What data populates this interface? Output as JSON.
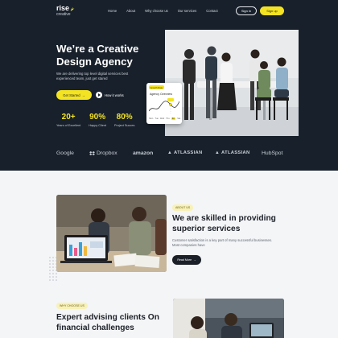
{
  "header": {
    "logo_name": "rise",
    "logo_tagline": "creative",
    "nav": [
      "Home",
      "About",
      "Why choose us",
      "Our services",
      "Contact"
    ],
    "signin_label": "Sign in",
    "signup_label": "Sign up"
  },
  "hero": {
    "title": "We’re a Creative Design Agency",
    "subtitle": "We are delivering top level digital services best experienced team, just get stared",
    "cta_label": "Get Started",
    "cta_arrow": "→",
    "how_label": "How it works",
    "photo": "image placeholder: team meeting around a table",
    "stats": [
      {
        "value": "20+",
        "label": "Years of Excellent"
      },
      {
        "value": "90%",
        "label": "Happy Client"
      },
      {
        "value": "80%",
        "label": "Project Succes"
      }
    ]
  },
  "overview_card": {
    "badge": "Growth Rate",
    "title": "Agency Overview",
    "days": [
      "Mon",
      "Tue",
      "Wed",
      "Thu",
      "Fri",
      "Sat"
    ],
    "active_day": "Fri",
    "accent": "#f3e323"
  },
  "brands": [
    "Google",
    "Dropbox",
    "amazon",
    "ATLASSIAN",
    "ATLASSIAN",
    "HubSpot"
  ],
  "about": {
    "badge": "ABOUT US",
    "title": "We are skilled in providing superior services",
    "text": "Customer satisfaction is a key part of many successful businesses. Most companies have",
    "button_label": "Read More",
    "button_arrow": "→",
    "photo": "image placeholder: people reviewing charts on a laptop"
  },
  "why": {
    "badge": "WHY CHOOSE US",
    "title": "Expert advising clients On financial challenges",
    "photo": "image placeholder: team working at a desk"
  },
  "colors": {
    "dark": "#18202b",
    "accent": "#f3e323",
    "light_bg": "#f4f5f7"
  }
}
